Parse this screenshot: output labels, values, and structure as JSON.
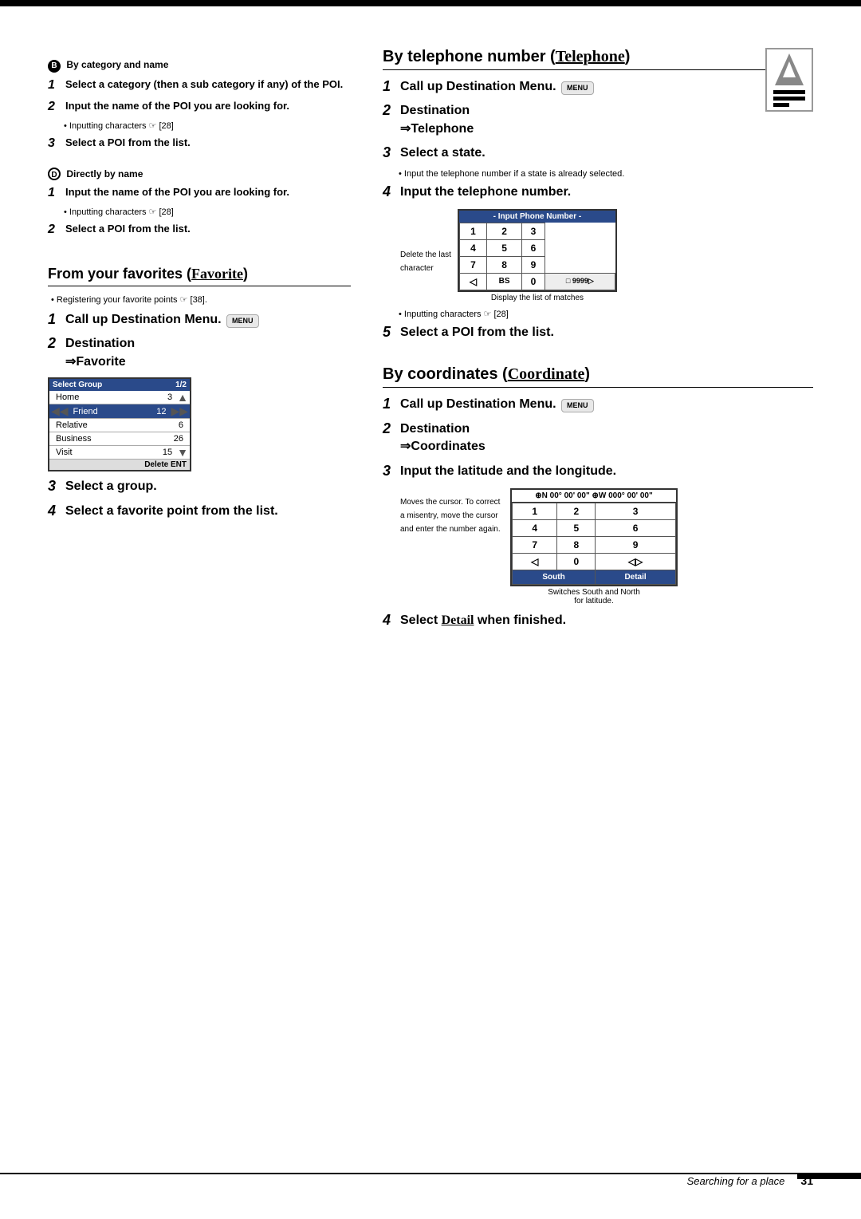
{
  "page": {
    "footer_text": "Searching for a place",
    "footer_page": "31"
  },
  "left_col": {
    "section_b_label": "By category and name",
    "section_b_circle": "B",
    "steps_b": [
      {
        "num": "1",
        "text": "Select a category (then a sub category if any) of the POI."
      },
      {
        "num": "2",
        "text": "Input the name of the POI you are looking for."
      },
      {
        "num": "3",
        "text": "Select a POI from the list."
      }
    ],
    "bullet_b": "Inputting characters ☞ [28]",
    "section_c_label": "Directly by name",
    "section_c_circle": "D",
    "steps_c": [
      {
        "num": "1",
        "text": "Input the name of the POI you are looking for."
      },
      {
        "num": "2",
        "text": "Select a POI from the list."
      }
    ],
    "bullet_c": "Inputting characters ☞ [28]",
    "favorites_title": "From your favorites (Favorite)",
    "favorites_bold": "Favorite",
    "registering_note": "Registering your favorite points ☞ [38].",
    "steps_fav": [
      {
        "num": "1",
        "text": "Call up Destination Menu."
      },
      {
        "num": "2",
        "text": "Destination\n⇒Favorite"
      },
      {
        "num": "3",
        "text": "Select a group."
      },
      {
        "num": "4",
        "text": "Select a favorite point from the list."
      }
    ],
    "fav_screen": {
      "title": "Select Group",
      "page": "1/2",
      "rows": [
        {
          "name": "Home",
          "num": "3",
          "selected": false
        },
        {
          "name": "Friend",
          "num": "12",
          "selected": true
        },
        {
          "name": "Relative",
          "num": "6",
          "selected": false
        },
        {
          "name": "Business",
          "num": "26",
          "selected": false
        },
        {
          "name": "Visit",
          "num": "15",
          "selected": false
        }
      ],
      "footer": "Delete ENT"
    }
  },
  "right_col": {
    "telephone_title": "By telephone number (Telephone)",
    "telephone_bold": "Telephone",
    "steps_tel": [
      {
        "num": "1",
        "text": "Call up Destination Menu."
      },
      {
        "num": "2",
        "text": "Destination\n⇒Telephone"
      },
      {
        "num": "3",
        "text": "Select a state."
      },
      {
        "num": "4",
        "text": "Input the telephone number."
      },
      {
        "num": "5",
        "text": "Select a POI from the list."
      }
    ],
    "tel_bullet_3": "Input the telephone number if a state is already selected.",
    "tel_bullet_4": "Inputting characters ☞ [28]",
    "tel_screen": {
      "title": "- Input Phone Number -",
      "rows": [
        [
          "1",
          "2",
          "3"
        ],
        [
          "4",
          "5",
          "6"
        ],
        [
          "7",
          "8",
          "9"
        ],
        [
          "◁",
          "BS",
          "0",
          "□ 9999"
        ]
      ]
    },
    "tel_display_note": "Display the list of matches",
    "tel_delete_note": "Delete the last character",
    "coordinates_title": "By coordinates (Coordinate)",
    "coordinates_bold": "Coordinate",
    "steps_coord": [
      {
        "num": "1",
        "text": "Call up Destination Menu."
      },
      {
        "num": "2",
        "text": "Destination\n⇒Coordinates"
      },
      {
        "num": "3",
        "text": "Input the latitude and the longitude."
      },
      {
        "num": "4",
        "text": "Select Detail when finished."
      }
    ],
    "coord_screen": {
      "title": "⊕N 00° 00' 00\" ⊕W 000° 00' 00\"",
      "rows": [
        [
          "1",
          "2",
          "3"
        ],
        [
          "4",
          "5",
          "6"
        ],
        [
          "7",
          "8",
          "9"
        ],
        [
          "◁",
          "0",
          "◁ ▷"
        ]
      ],
      "footer_left": "South",
      "footer_right": "Detail"
    },
    "coord_cursor_note": "Moves the cursor. To correct a misentry, move the cursor and enter the number again.",
    "coord_south_note": "Switches South and North for latitude."
  }
}
